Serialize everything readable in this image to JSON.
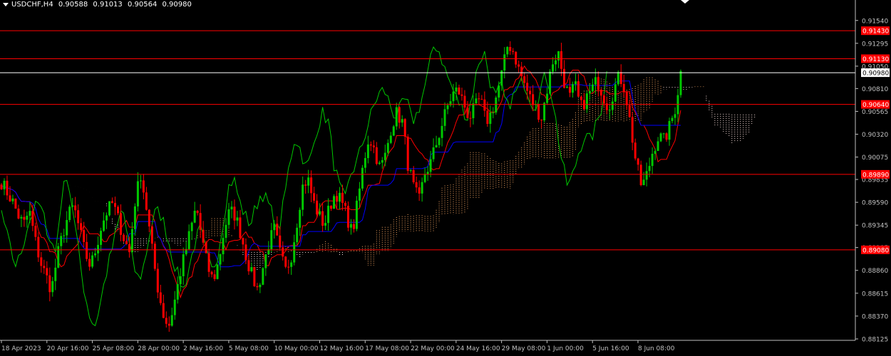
{
  "header": {
    "symbol": "USDCHF,H4",
    "open": "0.90588",
    "high": "0.91013",
    "low": "0.90564",
    "close": "0.90980"
  },
  "chart_data": {
    "type": "candlestick",
    "symbol": "USDCHF",
    "timeframe": "H4",
    "ylim": [
      0.88125,
      0.91645
    ],
    "y_ticks": [
      "0.91540",
      "0.91295",
      "0.91050",
      "0.90810",
      "0.90565",
      "0.90320",
      "0.90075",
      "0.89835",
      "0.89590",
      "0.89345",
      "0.89105",
      "0.88860",
      "0.88615",
      "0.88370",
      "0.88125"
    ],
    "x_ticks": [
      "18 Apr 2023",
      "20 Apr 16:00",
      "25 Apr 08:00",
      "28 Apr 00:00",
      "2 May 16:00",
      "5 May 08:00",
      "10 May 00:00",
      "12 May 16:00",
      "17 May 08:00",
      "22 May 00:00",
      "24 May 16:00",
      "29 May 08:00",
      "1 Jun 00:00",
      "5 Jun 16:00",
      "8 Jun 08:00"
    ],
    "horizontal_levels": [
      {
        "value": 0.9143,
        "label": "0.91430",
        "color": "#ff0000"
      },
      {
        "value": 0.9113,
        "label": "0.91130",
        "color": "#ff0000"
      },
      {
        "value": 0.9064,
        "label": "0.90640",
        "color": "#ff0000"
      },
      {
        "value": 0.8989,
        "label": "0.89890",
        "color": "#ff0000"
      },
      {
        "value": 0.8908,
        "label": "0.89080",
        "color": "#ff0000"
      }
    ],
    "current_price": {
      "value": 0.9098,
      "label": "0.90980",
      "color": "#ffffff"
    },
    "colors": {
      "bull": "#00c800",
      "bear": "#ff0000",
      "tenkan": "#ff0000",
      "kijun": "#0000ff",
      "chikou": "#00c800",
      "cloud_a": "#f4a460",
      "cloud_b": "#ffe4e1",
      "grid_axis": "#c0c0c0"
    },
    "price_path": [
      0.8981,
      0.897,
      0.896,
      0.8945,
      0.8935,
      0.895,
      0.892,
      0.8895,
      0.888,
      0.8865,
      0.89,
      0.8925,
      0.8945,
      0.8955,
      0.893,
      0.8905,
      0.889,
      0.891,
      0.8935,
      0.895,
      0.8958,
      0.894,
      0.892,
      0.8905,
      0.896,
      0.899,
      0.8955,
      0.891,
      0.887,
      0.884,
      0.8825,
      0.885,
      0.888,
      0.8905,
      0.893,
      0.8955,
      0.892,
      0.889,
      0.8875,
      0.8895,
      0.893,
      0.895,
      0.8945,
      0.8925,
      0.89,
      0.888,
      0.8865,
      0.889,
      0.8915,
      0.893,
      0.8905,
      0.8885,
      0.89,
      0.8935,
      0.8975,
      0.8985,
      0.896,
      0.8945,
      0.8935,
      0.8955,
      0.897,
      0.896,
      0.8945,
      0.8925,
      0.896,
      0.9,
      0.903,
      0.9015,
      0.8995,
      0.901,
      0.904,
      0.9055,
      0.9045,
      0.9,
      0.8975,
      0.896,
      0.899,
      0.9,
      0.902,
      0.904,
      0.906,
      0.9075,
      0.908,
      0.9065,
      0.905,
      0.906,
      0.907,
      0.9045,
      0.9055,
      0.9075,
      0.91,
      0.913,
      0.912,
      0.91,
      0.9085,
      0.907,
      0.906,
      0.905,
      0.908,
      0.911,
      0.912,
      0.909,
      0.907,
      0.9085,
      0.906,
      0.907,
      0.908,
      0.909,
      0.9075,
      0.906,
      0.908,
      0.9095,
      0.908,
      0.904,
      0.9,
      0.8975,
      0.899,
      0.9015,
      0.903,
      0.9025,
      0.904,
      0.906,
      0.9098
    ]
  }
}
